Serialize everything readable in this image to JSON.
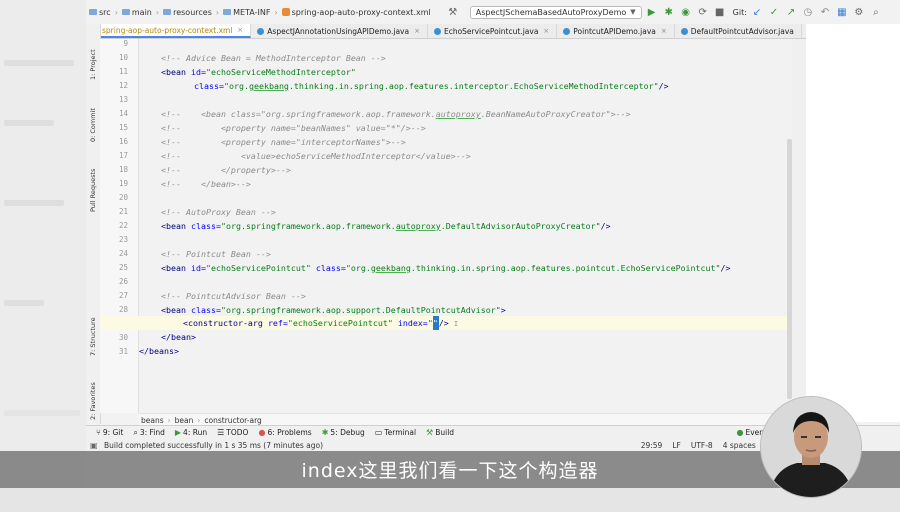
{
  "navbar": {
    "crumbs": [
      "src",
      "main",
      "resources",
      "META-INF"
    ],
    "current_file": "spring-aop-auto-proxy-context.xml",
    "run_config": "AspectJSchemaBasedAutoProxyDemo",
    "git_label": "Git:"
  },
  "tabs": [
    {
      "label": "spring-aop-auto-proxy-context.xml",
      "color": "#e58b3a",
      "active": true
    },
    {
      "label": "AspectJAnnotationUsingAPIDemo.java",
      "color": "#3b8fd4",
      "active": false
    },
    {
      "label": "EchoServicePointcut.java",
      "color": "#3b8fd4",
      "active": false
    },
    {
      "label": "PointcutAPIDemo.java",
      "color": "#3b8fd4",
      "active": false
    },
    {
      "label": "DefaultPointcutAdvisor.java",
      "color": "#3b8fd4",
      "active": false
    }
  ],
  "left_tools": {
    "project": "1: Project",
    "commit": "0: Commit",
    "pull_requests": "Pull Requests",
    "structure": "7: Structure",
    "favorites": "2: Favorites"
  },
  "code": {
    "line_numbers": [
      "9",
      "10",
      "11",
      "12",
      "13",
      "14",
      "15",
      "16",
      "17",
      "18",
      "19",
      "20",
      "21",
      "22",
      "23",
      "24",
      "25",
      "26",
      "27",
      "28",
      "29",
      "30",
      "31"
    ],
    "l10": "<!-- Advice Bean = MethodInterceptor Bean -->",
    "l11_bean": "<bean",
    "l11_attr": "id=",
    "l11_val": "\"echoServiceMethodInterceptor\"",
    "l12_attr": "class=",
    "l12_val_a": "\"org.",
    "l12_val_u": "geekbang",
    "l12_val_b": ".thinking.in.spring.aop.features.interceptor.EchoServiceMethodInterceptor\"",
    "l12_end": "/>",
    "l14_a": "<!--    <bean class=\"org.springframework.aop.framework.",
    "l14_u": "autoproxy",
    "l14_b": ".BeanNameAutoProxyCreator\">-->",
    "l15": "<!--        <property name=\"beanNames\" value=\"*\"/>-->",
    "l16": "<!--        <property name=\"interceptorNames\">-->",
    "l17": "<!--            <value>echoServiceMethodInterceptor</value>-->",
    "l18": "<!--        </property>-->",
    "l19": "<!--    </bean>-->",
    "l22": "<!-- AutoProxy Bean -->",
    "l23_bean": "<bean",
    "l23_attr": "class=",
    "l23_val_a": "\"org.springframework.aop.framework.",
    "l23_val_u": "autoproxy",
    "l23_val_b": ".DefaultAdvisorAutoProxyCreator\"",
    "l23_end": "/>",
    "l25": "<!-- Pointcut Bean -->",
    "l26_bean": "<bean",
    "l26_attr1": "id=",
    "l26_val1": "\"echoServicePointcut\"",
    "l26_attr2": "class=",
    "l26_val2_a": "\"org.",
    "l26_val2_u": "geekbang",
    "l26_val2_b": ".thinking.in.spring.aop.features.pointcut.EchoServicePointcut\"",
    "l26_end": "/>",
    "l28": "<!-- PointcutAdvisor Bean -->",
    "l29_bean": "<bean",
    "l29_attr": "class=",
    "l29_val": "\"org.springframework.aop.support.DefaultPointcutAdvisor\"",
    "l29_end": ">",
    "l30_tag": "<constructor-arg",
    "l30_attr1": "ref=",
    "l30_val1": "\"echoServicePointcut\"",
    "l30_attr2": "index=",
    "l30_q1": "\"",
    "l30_q2": "\"",
    "l30_end": "/>",
    "l31": "</bean>",
    "l32": "</beans>"
  },
  "breadcrumbs": [
    "beans",
    "bean",
    "constructor-arg"
  ],
  "tool_windows": [
    {
      "icon": "git-icon",
      "label": "9: Git"
    },
    {
      "icon": "find-icon",
      "label": "3: Find"
    },
    {
      "icon": "run-icon",
      "label": "4: Run"
    },
    {
      "icon": "todo-icon",
      "label": "TODO"
    },
    {
      "icon": "problems-icon",
      "label": "6: Problems"
    },
    {
      "icon": "debug-icon",
      "label": "5: Debug"
    },
    {
      "icon": "terminal-icon",
      "label": "Terminal"
    },
    {
      "icon": "build-icon",
      "label": "Build"
    }
  ],
  "event_log": "Even",
  "status": {
    "message": "Build completed successfully in 1 s 35 ms (7 minutes ago)",
    "position": "29:59",
    "line_sep": "LF",
    "encoding": "UTF-8",
    "indent": "4 spaces",
    "branch": "m"
  },
  "subtitle": "index这里我们看一下这个构造器"
}
